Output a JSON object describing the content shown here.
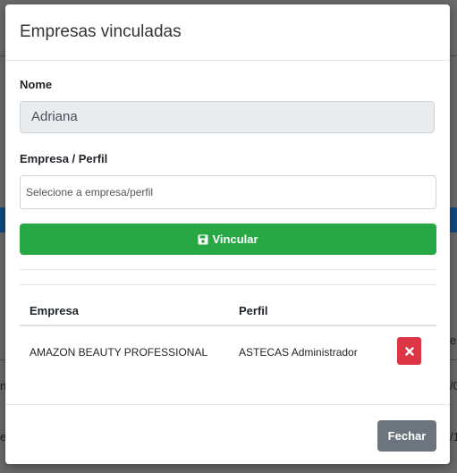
{
  "background": {
    "fragments": [
      "e",
      "/0",
      "n",
      "e",
      "/1"
    ]
  },
  "modal": {
    "title": "Empresas vinculadas",
    "name_label": "Nome",
    "name_value": "Adriana",
    "company_label": "Empresa / Perfil",
    "company_placeholder": "Selecione a empresa/perfil",
    "link_button": {
      "label": "Vincular",
      "icon": "save-icon"
    },
    "table": {
      "headers": [
        "Empresa",
        "Perfil"
      ],
      "rows": [
        {
          "empresa": "AMAZON BEAUTY PROFESSIONAL",
          "perfil": "ASTECAS Administrador",
          "action_icon": "close-icon"
        }
      ]
    },
    "close_button": "Fechar"
  },
  "colors": {
    "success": "#28a745",
    "danger": "#dc3545",
    "secondary": "#6c757d",
    "background_accent": "#0f4a80"
  }
}
